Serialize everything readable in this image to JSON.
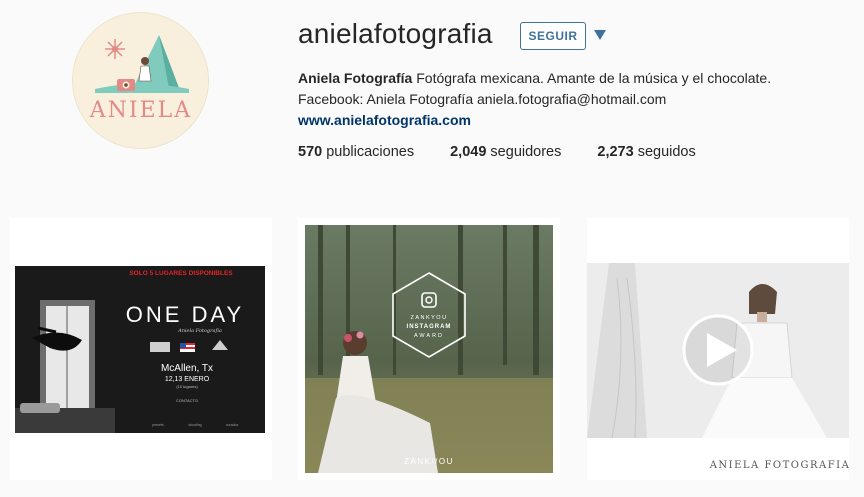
{
  "profile": {
    "username": "anielafotografia",
    "follow_label": "SEGUIR",
    "avatar_text": "ANIELA",
    "bio_name": "Aniela Fotografía",
    "bio_text": " Fotógrafa mexicana. Amante de la música y el chocolate.",
    "bio_line2": "Facebook: Aniela Fotografía aniela.fotografia@hotmail.com",
    "website": "www.anielafotografia.com"
  },
  "stats": {
    "posts_count": "570",
    "posts_label": " publicaciones",
    "followers_count": "2,049",
    "followers_label": " seguidores",
    "following_count": "2,273",
    "following_label": " seguidos"
  },
  "posts": [
    {
      "banner": "SOLO 5 LUGARES DISPONIBLES",
      "title": "ONE DAY",
      "subtitle": "Aniela Fotografía",
      "city": "McAllen, Tx",
      "dates": "12,13 ENERO",
      "note": "(10 lugares)",
      "contact": "CONTACTO",
      "footer_left": "presets",
      "footer_mid": "shooting",
      "footer_right": "curados"
    },
    {
      "award_line1": "ZANKYOU",
      "award_line2": "INSTAGRAM",
      "award_line3": "AWARD",
      "brand": "ZANK//OU"
    },
    {
      "signature": "ANIELA FOTOGRAFIA",
      "icon": "play-icon"
    }
  ],
  "colors": {
    "accent": "#3f729b",
    "link": "#003569",
    "banner_red": "#e0252b"
  }
}
